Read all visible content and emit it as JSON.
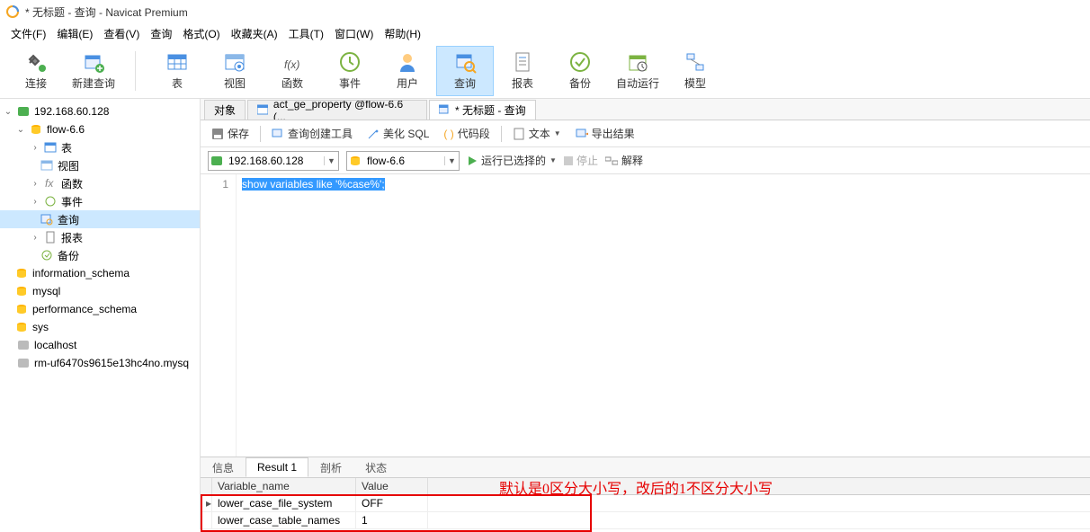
{
  "window": {
    "title": "* 无标题 - 查询 - Navicat Premium"
  },
  "menu": [
    "文件(F)",
    "编辑(E)",
    "查看(V)",
    "查询",
    "格式(O)",
    "收藏夹(A)",
    "工具(T)",
    "窗口(W)",
    "帮助(H)"
  ],
  "toolbar": {
    "connect": "连接",
    "new_query": "新建查询",
    "table": "表",
    "view": "视图",
    "function": "函数",
    "event": "事件",
    "user": "用户",
    "query": "查询",
    "report": "报表",
    "backup": "备份",
    "auto_run": "自动运行",
    "model": "模型"
  },
  "tree": {
    "conn1": "192.168.60.128",
    "db1": "flow-6.6",
    "tables": "表",
    "views": "视图",
    "functions": "函数",
    "events": "事件",
    "queries": "查询",
    "reports": "报表",
    "backups": "备份",
    "db2": "information_schema",
    "db3": "mysql",
    "db4": "performance_schema",
    "db5": "sys",
    "conn2": "localhost",
    "conn3": "rm-uf6470s9615e13hc4no.mysq"
  },
  "tabs": {
    "objects": "对象",
    "tab1": "act_ge_property @flow-6.6 (...",
    "tab2": "* 无标题 - 查询"
  },
  "qtb": {
    "save": "保存",
    "builder": "查询创建工具",
    "beautify": "美化 SQL",
    "snippet": "代码段",
    "text": "文本",
    "export": "导出结果"
  },
  "combo": {
    "conn": "192.168.60.128",
    "db": "flow-6.6"
  },
  "run": {
    "run": "运行已选择的",
    "stop": "停止",
    "explain": "解释"
  },
  "sql": {
    "line": "1",
    "text": "show variables like '%case%';"
  },
  "rtabs": {
    "info": "信息",
    "result": "Result 1",
    "profile": "剖析",
    "status": "状态"
  },
  "grid": {
    "col1": "Variable_name",
    "col2": "Value",
    "rows": [
      {
        "name": "lower_case_file_system",
        "value": "OFF"
      },
      {
        "name": "lower_case_table_names",
        "value": "1"
      }
    ]
  },
  "annotation": "默认是0区分大小写，改后的1不区分大小写"
}
